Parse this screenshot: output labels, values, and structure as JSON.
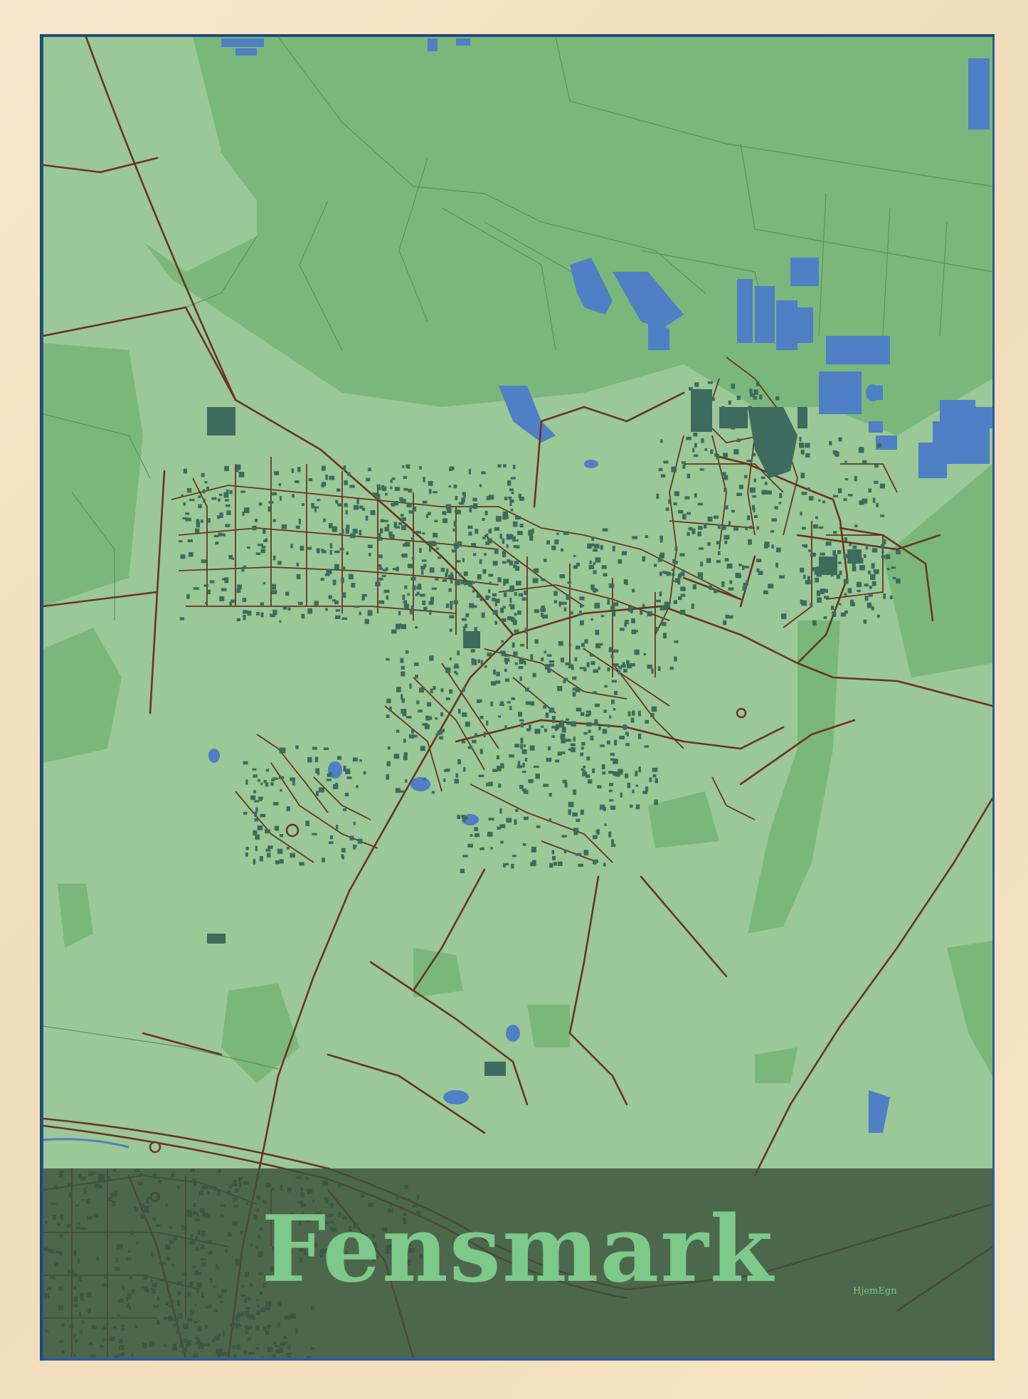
{
  "poster": {
    "city_name": "Fensmark",
    "brand_mark": "HjemEgn"
  },
  "colors": {
    "frame_wood": "#f3e3c4",
    "land_light": "#9ac896",
    "land_mid": "#79b87a",
    "land_dark": "#6aae6d",
    "water": "#4f7fc4",
    "buildings": "#3d6b5e",
    "roads": "#6b3422",
    "band": "#3c523c",
    "title_text": "#7cc98a",
    "brand_text": "#7cc98a"
  },
  "map_features": {
    "style": "street-map poster",
    "legend": "none",
    "icons": [
      "roundabout-marker"
    ]
  }
}
